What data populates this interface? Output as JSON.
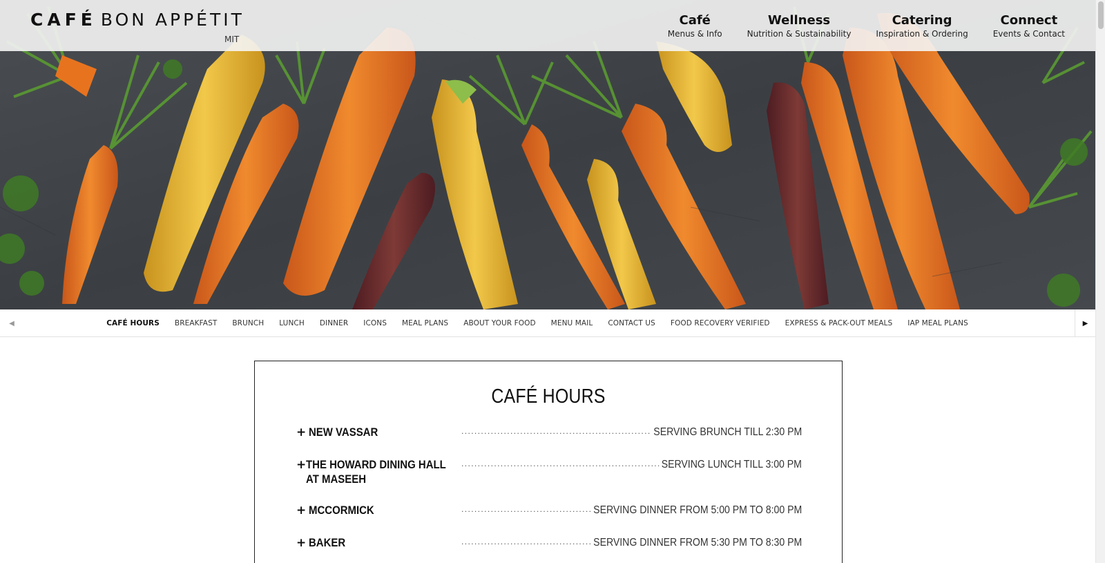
{
  "header": {
    "logo_bold": "CAFÉ",
    "logo_light": "BON APPÉTIT",
    "logo_sub": "MIT",
    "nav": [
      {
        "title": "Café",
        "sub": "Menus & Info"
      },
      {
        "title": "Wellness",
        "sub": "Nutrition & Sustainability"
      },
      {
        "title": "Catering",
        "sub": "Inspiration & Ordering"
      },
      {
        "title": "Connect",
        "sub": "Events & Contact"
      }
    ]
  },
  "subnav": {
    "items": [
      "CAFÉ HOURS",
      "BREAKFAST",
      "BRUNCH",
      "LUNCH",
      "DINNER",
      "ICONS",
      "MEAL PLANS",
      "ABOUT YOUR FOOD",
      "MENU MAIL",
      "CONTACT US",
      "FOOD RECOVERY VERIFIED",
      "EXPRESS & PACK-OUT MEALS",
      "IAP MEAL PLANS"
    ],
    "active": "CAFÉ HOURS",
    "left_arrow_icon": "chevron-left-icon",
    "right_arrow_icon": "chevron-right-icon"
  },
  "hours": {
    "title": "CAFÉ HOURS",
    "rows": [
      {
        "name_line1": "NEW VASSAR",
        "name_line2": "",
        "serving": "SERVING BRUNCH TILL 2:30 PM"
      },
      {
        "name_line1": "THE HOWARD DINING HALL",
        "name_line2": "AT MASEEH",
        "serving": "SERVING LUNCH TILL 3:00 PM"
      },
      {
        "name_line1": "MCCORMICK",
        "name_line2": "",
        "serving": "SERVING DINNER FROM 5:00 PM TO 8:00 PM"
      },
      {
        "name_line1": "BAKER",
        "name_line2": "",
        "serving": "SERVING DINNER FROM 5:30 PM TO 8:30 PM"
      }
    ],
    "expand_icon": "plus-icon"
  },
  "colors": {
    "hero_background": "#3d4145",
    "carrot_orange": "#e8731f",
    "carrot_yellow": "#e8b52a",
    "carrot_purple": "#6a2a2e",
    "greens": "#4f8a2e"
  }
}
